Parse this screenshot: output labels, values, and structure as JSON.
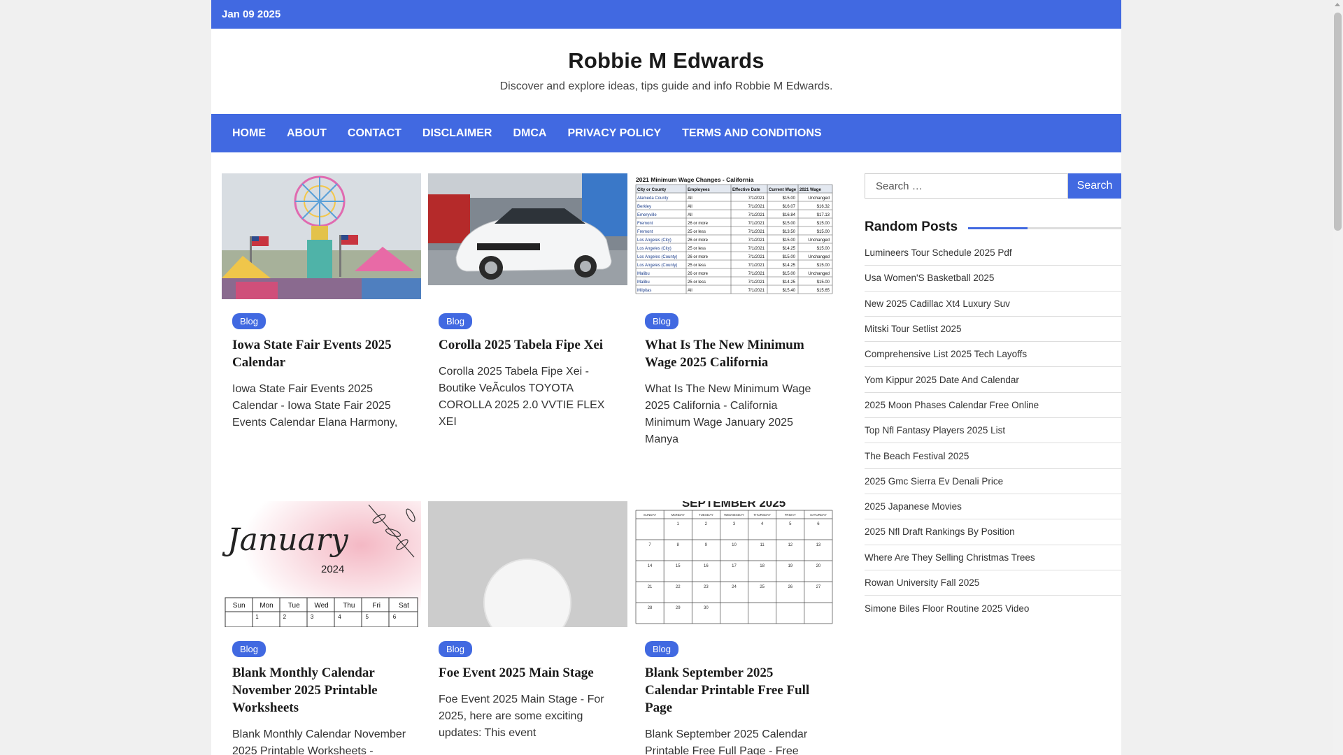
{
  "topbar": {
    "date": "Jan 09 2025"
  },
  "site": {
    "title": "Robbie M Edwards",
    "description": "Discover and explore ideas, tips guide and info Robbie M Edwards."
  },
  "nav": {
    "items": [
      {
        "label": "HOME"
      },
      {
        "label": "ABOUT"
      },
      {
        "label": "CONTACT"
      },
      {
        "label": "DISCLAIMER"
      },
      {
        "label": "DMCA"
      },
      {
        "label": "PRIVACY POLICY"
      },
      {
        "label": "TERMS AND CONDITIONS"
      }
    ]
  },
  "posts": [
    {
      "category": "Blog",
      "title": "Iowa State Fair Events 2025 Calendar",
      "excerpt": "Iowa State Fair Events 2025 Calendar - Iowa State Fair 2025 Events Calendar Elana Harmony,",
      "image": "fair-ferris-wheel-photo"
    },
    {
      "category": "Blog",
      "title": "Corolla 2025 Tabela Fipe Xei",
      "excerpt": "Corolla 2025 Tabela Fipe Xei - Boutike VeÃculos TOYOTA COROLLA 2025 2.0 VVTIE FLEX XEI",
      "image": "white-car-photo"
    },
    {
      "category": "Blog",
      "title": "What Is The New Minimum Wage 2025 California",
      "excerpt": "What Is The New Minimum Wage 2025 California - California Minimum Wage January 2025 Manya",
      "image": "wage-table-image"
    },
    {
      "category": "Blog",
      "title": "Blank Monthly Calendar November 2025 Printable Worksheets",
      "excerpt": "Blank Monthly Calendar November 2025 Printable Worksheets -",
      "image": "january-calendar-image"
    },
    {
      "category": "Blog",
      "title": "Foe Event 2025 Main Stage",
      "excerpt": "Foe Event 2025 Main Stage - For 2025, here are some exciting updates: This event",
      "image": "placeholder-avatar-image"
    },
    {
      "category": "Blog",
      "title": "Blank September 2025 Calendar Printable Free Full Page",
      "excerpt": "Blank September 2025 Calendar Printable Free Full Page - Free",
      "image": "september-calendar-image"
    }
  ],
  "thumb_text": {
    "wage_heading": "2021 Minimum Wage Changes - California",
    "wage_cols": [
      "City or County",
      "Employees",
      "Effective Date",
      "Current Wage",
      "2021 Wage"
    ],
    "wage_rows": [
      [
        "Alameda County",
        "All",
        "7/1/2021",
        "$15.00",
        "Unchanged"
      ],
      [
        "Berkley",
        "All",
        "7/1/2021",
        "$16.07",
        "$16.32"
      ],
      [
        "Emeryville",
        "All",
        "7/1/2021",
        "$16.84",
        "$17.13"
      ],
      [
        "Fremont",
        "26 or more",
        "7/1/2021",
        "$15.00",
        "$15.00"
      ],
      [
        "Fremont",
        "25 or less",
        "7/1/2021",
        "$13.50",
        "$15.00"
      ],
      [
        "Los Angeles (City)",
        "26 or more",
        "7/1/2021",
        "$15.00",
        "Unchanged"
      ],
      [
        "Los Angeles (City)",
        "25 or less",
        "7/1/2021",
        "$14.25",
        "$15.00"
      ],
      [
        "Los Angeles (County)",
        "26 or more",
        "7/1/2021",
        "$15.00",
        "Unchanged"
      ],
      [
        "Los Angeles (County)",
        "25 or less",
        "7/1/2021",
        "$14.25",
        "$15.00"
      ],
      [
        "Malibu",
        "26 or more",
        "7/1/2021",
        "$15.00",
        "Unchanged"
      ],
      [
        "Malibu",
        "25 or less",
        "7/1/2021",
        "$14.25",
        "$15.00"
      ],
      [
        "Milpitas",
        "All",
        "7/1/2021",
        "$15.40",
        "$15.65"
      ]
    ],
    "jan_month": "January",
    "jan_year": "2024",
    "jan_days": [
      "Sun",
      "Mon",
      "Tue",
      "Wed",
      "Thu",
      "Fri",
      "Sat"
    ],
    "jan_dates": [
      "1",
      "2",
      "3",
      "4",
      "5",
      "6"
    ],
    "sep_heading": "SEPTEMBER 2025",
    "sep_days": [
      "SUNDAY",
      "MONDAY",
      "TUESDAY",
      "WEDNESDAY",
      "THURSDAY",
      "FRIDAY",
      "SATURDAY"
    ],
    "sep_dates": [
      "1",
      "2",
      "3",
      "4",
      "5",
      "6",
      "7",
      "8",
      "9",
      "10",
      "11",
      "12",
      "13",
      "14",
      "15",
      "16",
      "17",
      "18",
      "19",
      "20",
      "21",
      "22",
      "23",
      "24",
      "25",
      "26",
      "27",
      "28",
      "29",
      "30"
    ]
  },
  "sidebar": {
    "search": {
      "placeholder": "Search …",
      "button_label": "Search"
    },
    "random_posts": {
      "title": "Random Posts",
      "items": [
        "Lumineers Tour Schedule 2025 Pdf",
        "Usa Women'S Basketball 2025",
        "New 2025 Cadillac Xt4 Luxury Suv",
        "Mitski Tour Setlist 2025",
        "Comprehensive List 2025 Tech Layoffs",
        "Yom Kippur 2025 Date And Calendar",
        "2025 Moon Phases Calendar Free Online",
        "Top Nfl Fantasy Players 2025 List",
        "The Beach Festival 2025",
        "2025 Gmc Sierra Ev Denali Price",
        "2025 Japanese Movies",
        "2025 Nfl Draft Rankings By Position",
        "Where Are They Selling Christmas Trees",
        "Rowan University Fall 2025",
        "Simone Biles Floor Routine 2025 Video"
      ]
    }
  },
  "colors": {
    "accent": "#4169e1",
    "page_bg": "#f0f0f0"
  }
}
